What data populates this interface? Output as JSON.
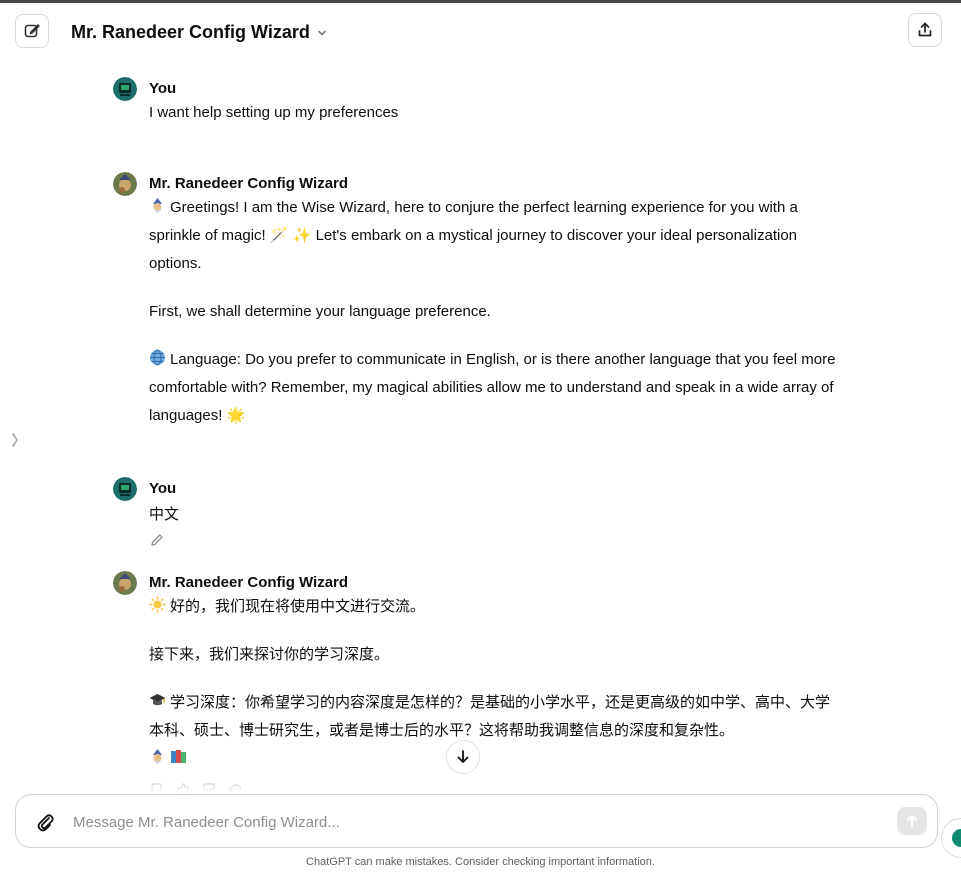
{
  "header": {
    "title": "Mr. Ranedeer Config Wizard"
  },
  "messages": [
    {
      "author": "You",
      "text": "I want help setting up my preferences"
    },
    {
      "author": "Mr. Ranedeer Config Wizard",
      "paragraphs": [
        "Greetings! I am the Wise Wizard, here to conjure the perfect learning experience for you with a sprinkle of magic! 🪄 ✨ Let's embark on a mystical journey to discover your ideal personalization options.",
        "First, we shall determine your language preference.",
        "Language: Do you prefer to communicate in English, or is there another language that you feel more comfortable with? Remember, my magical abilities allow me to understand and speak in a wide array of languages! 🌟"
      ]
    },
    {
      "author": "You",
      "text": "中文"
    },
    {
      "author": "Mr. Ranedeer Config Wizard",
      "paragraphs": [
        "好的，我们现在将使用中文进行交流。",
        "接下来，我们来探讨你的学习深度。",
        "学习深度：你希望学习的内容深度是怎样的？是基础的小学水平，还是更高级的如中学、高中、大学本科、硕士、博士研究生，或者是博士后的水平？这将帮助我调整信息的深度和复杂性。"
      ]
    }
  ],
  "composer": {
    "placeholder": "Message Mr. Ranedeer Config Wizard..."
  },
  "footer": {
    "disclaimer": "ChatGPT can make mistakes. Consider checking important information."
  },
  "icons": {
    "new_chat": "compose-icon",
    "share": "share-icon",
    "attach": "paperclip-icon",
    "send": "arrow-up-icon",
    "scroll": "arrow-down-icon"
  }
}
